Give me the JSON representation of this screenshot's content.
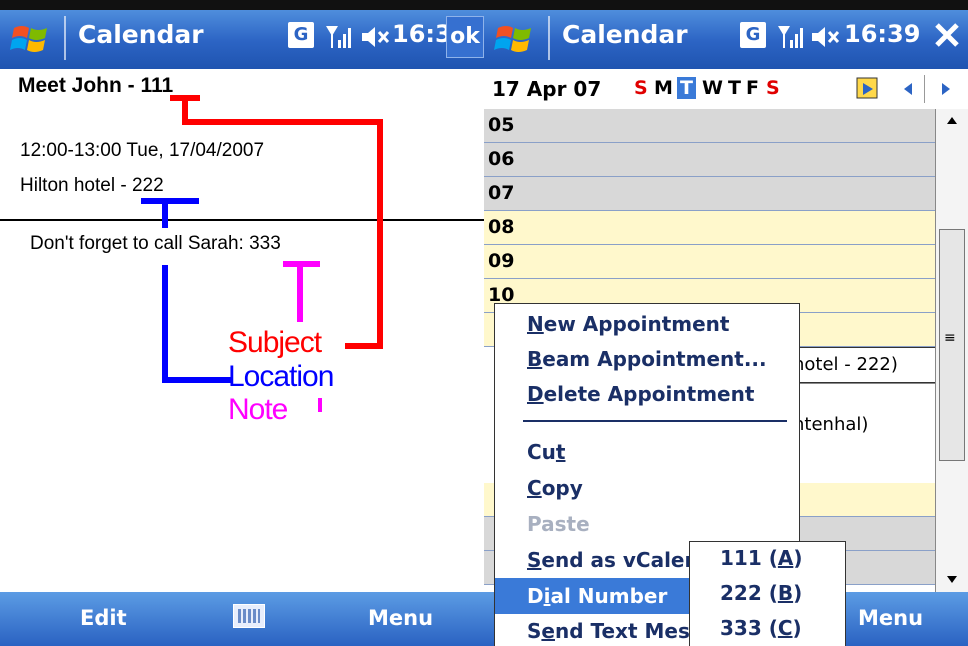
{
  "left": {
    "title": "Calendar",
    "status": {
      "g_label": "G",
      "time": "16:39",
      "ok_label": "ok"
    },
    "subject": "Meet John - 111",
    "datetime": "12:00-13:00 Tue, 17/04/2007",
    "location": "Hilton hotel - 222",
    "note": "Don't forget to call Sarah: 333",
    "annotations": {
      "subject": "Subject",
      "location": "Location",
      "note": "Note"
    },
    "softkeys": {
      "left": "Edit",
      "right": "Menu"
    },
    "colors": {
      "subject": "#ff0000",
      "location": "#0000ff",
      "note": "#ff00ff"
    }
  },
  "right": {
    "title": "Calendar",
    "status": {
      "g_label": "G",
      "time": "16:39"
    },
    "date_label": "17 Apr 07",
    "days": [
      "S",
      "M",
      "T",
      "W",
      "T",
      "F",
      "S"
    ],
    "hours": [
      "05",
      "06",
      "07",
      "08",
      "09",
      "10"
    ],
    "background_text": [
      "hotel - 222)",
      "ntenhal)"
    ],
    "menu_items": [
      {
        "pre": "",
        "u": "N",
        "post": "ew Appointment"
      },
      {
        "pre": "",
        "u": "B",
        "post": "eam Appointment..."
      },
      {
        "pre": "",
        "u": "D",
        "post": "elete Appointment"
      },
      {
        "pre": "Cu",
        "u": "t",
        "post": ""
      },
      {
        "pre": "",
        "u": "C",
        "post": "opy"
      },
      {
        "pre": "Paste",
        "u": "",
        "post": ""
      },
      {
        "pre": "",
        "u": "S",
        "post": "end as vCaler"
      },
      {
        "pre": "D",
        "u": "i",
        "post": "al Number"
      },
      {
        "pre": "S",
        "u": "e",
        "post": "nd Text Mes"
      }
    ],
    "submenu_items": [
      {
        "pre": "111 (",
        "u": "A",
        "post": ")"
      },
      {
        "pre": "222 (",
        "u": "B",
        "post": ")"
      },
      {
        "pre": "333 (",
        "u": "C",
        "post": ")"
      }
    ],
    "softkeys": {
      "right": "Menu"
    }
  }
}
